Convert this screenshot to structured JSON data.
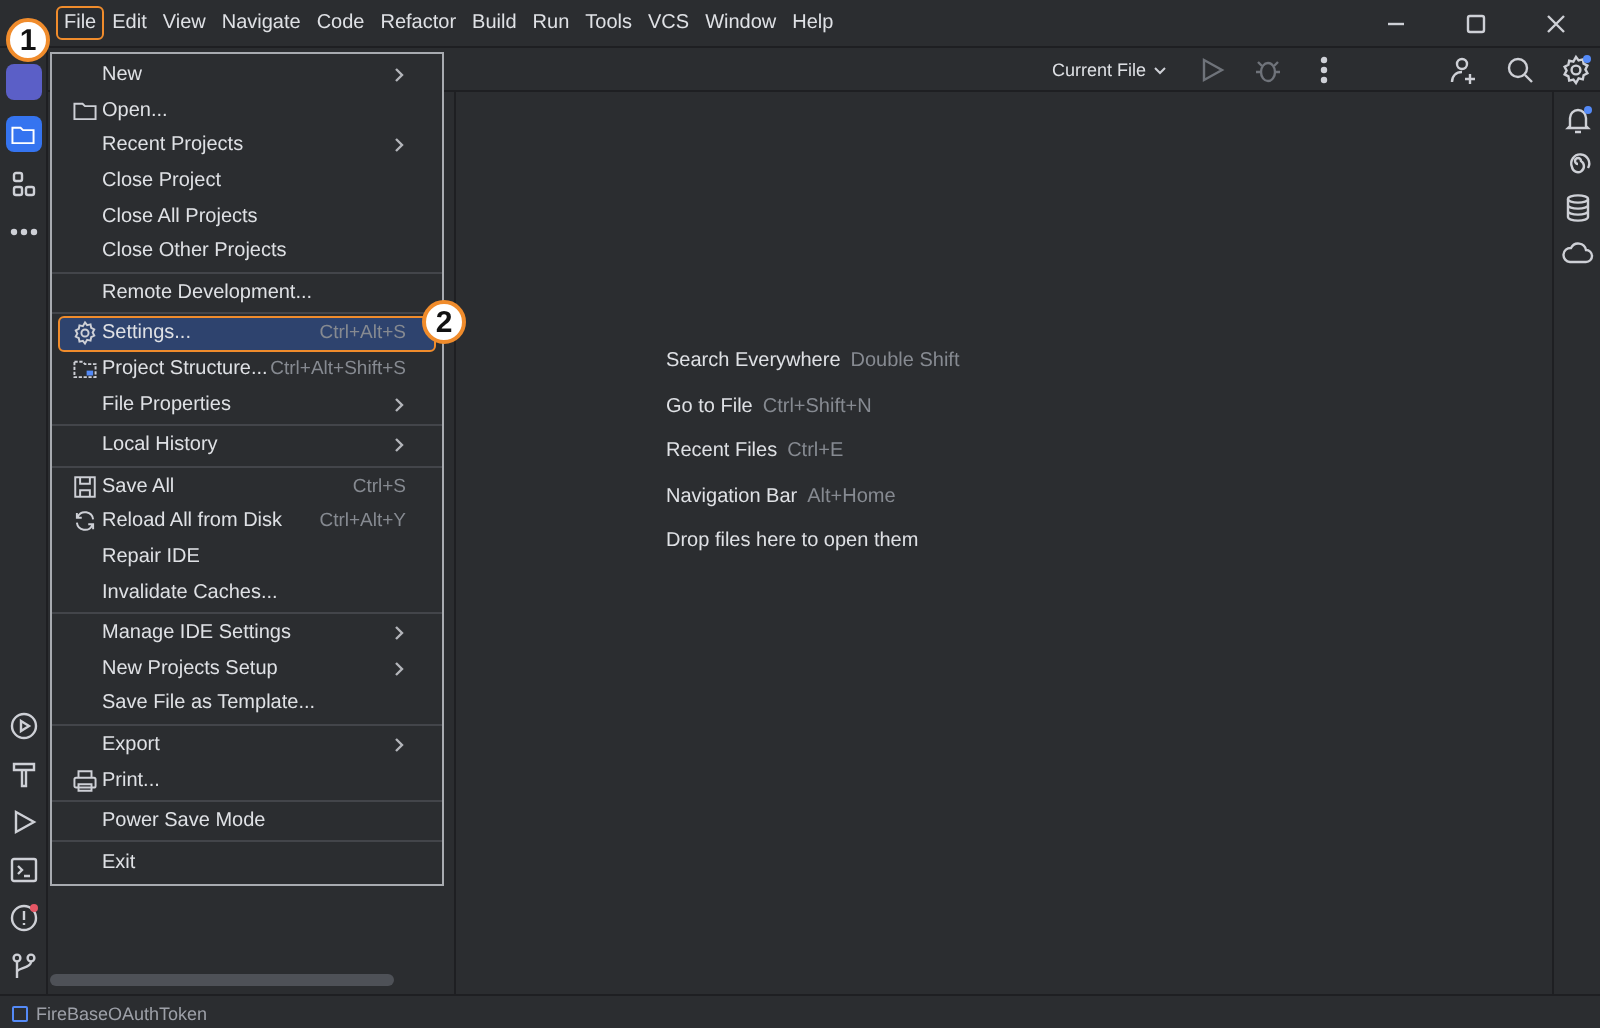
{
  "menu_bar": [
    {
      "label": "File",
      "selected": true
    },
    {
      "label": "Edit",
      "selected": false
    },
    {
      "label": "View",
      "selected": false
    },
    {
      "label": "Navigate",
      "selected": false
    },
    {
      "label": "Code",
      "selected": false
    },
    {
      "label": "Refactor",
      "selected": false
    },
    {
      "label": "Build",
      "selected": false
    },
    {
      "label": "Run",
      "selected": false
    },
    {
      "label": "Tools",
      "selected": false
    },
    {
      "label": "VCS",
      "selected": false
    },
    {
      "label": "Window",
      "selected": false
    },
    {
      "label": "Help",
      "selected": false
    }
  ],
  "toolbar": {
    "run_config": "Current File"
  },
  "file_menu": [
    {
      "kind": "item",
      "label": "New",
      "submenu": true,
      "selected": false
    },
    {
      "kind": "folder",
      "label": "Open...",
      "submenu": false,
      "selected": false
    },
    {
      "kind": "item",
      "label": "Recent Projects",
      "submenu": true,
      "selected": false
    },
    {
      "kind": "item",
      "label": "Close Project",
      "submenu": false,
      "selected": false
    },
    {
      "kind": "item",
      "label": "Close All Projects",
      "submenu": false,
      "selected": false
    },
    {
      "kind": "item",
      "label": "Close Other Projects",
      "submenu": false,
      "selected": false
    },
    {
      "kind": "separator"
    },
    {
      "kind": "item",
      "label": "Remote Development...",
      "submenu": false,
      "selected": false
    },
    {
      "kind": "separator"
    },
    {
      "kind": "gear",
      "label": "Settings...",
      "shortcut": "Ctrl+Alt+S",
      "submenu": false,
      "selected": true
    },
    {
      "kind": "structure",
      "label": "Project Structure...",
      "shortcut": "Ctrl+Alt+Shift+S",
      "submenu": false,
      "selected": false
    },
    {
      "kind": "item",
      "label": "File Properties",
      "submenu": true,
      "selected": false
    },
    {
      "kind": "separator"
    },
    {
      "kind": "item",
      "label": "Local History",
      "submenu": true,
      "selected": false
    },
    {
      "kind": "separator"
    },
    {
      "kind": "save",
      "label": "Save All",
      "shortcut": "Ctrl+S",
      "submenu": false,
      "selected": false
    },
    {
      "kind": "reload",
      "label": "Reload All from Disk",
      "shortcut": "Ctrl+Alt+Y",
      "submenu": false,
      "selected": false
    },
    {
      "kind": "item",
      "label": "Repair IDE",
      "submenu": false,
      "selected": false
    },
    {
      "kind": "item",
      "label": "Invalidate Caches...",
      "submenu": false,
      "selected": false
    },
    {
      "kind": "separator"
    },
    {
      "kind": "item",
      "label": "Manage IDE Settings",
      "submenu": true,
      "selected": false
    },
    {
      "kind": "item",
      "label": "New Projects Setup",
      "submenu": true,
      "selected": false
    },
    {
      "kind": "item",
      "label": "Save File as Template...",
      "submenu": false,
      "selected": false
    },
    {
      "kind": "separator"
    },
    {
      "kind": "item",
      "label": "Export",
      "submenu": true,
      "selected": false
    },
    {
      "kind": "print",
      "label": "Print...",
      "submenu": false,
      "selected": false
    },
    {
      "kind": "separator"
    },
    {
      "kind": "item",
      "label": "Power Save Mode",
      "submenu": false,
      "selected": false
    },
    {
      "kind": "separator"
    },
    {
      "kind": "item",
      "label": "Exit",
      "submenu": false,
      "selected": false
    }
  ],
  "callouts": [
    "1",
    "2"
  ],
  "welcome_hints": [
    {
      "action": "Search Everywhere",
      "shortcut": "Double Shift"
    },
    {
      "action": "Go to File",
      "shortcut": "Ctrl+Shift+N"
    },
    {
      "action": "Recent Files",
      "shortcut": "Ctrl+E"
    },
    {
      "action": "Navigation Bar",
      "shortcut": "Alt+Home"
    },
    {
      "action": "Drop files here to open them"
    }
  ],
  "status_bar": {
    "project": "FireBaseOAuthToken"
  }
}
